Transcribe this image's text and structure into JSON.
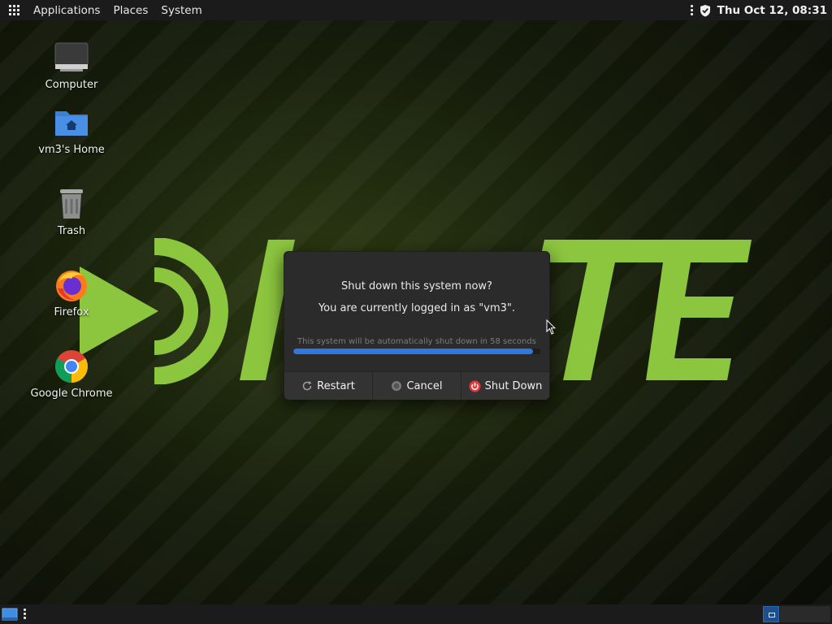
{
  "topbar": {
    "menus": [
      "Applications",
      "Places",
      "System"
    ],
    "clock": "Thu Oct 12, 08:31"
  },
  "desktop": {
    "icons": [
      {
        "label": "Computer",
        "icon": "computer-icon"
      },
      {
        "label": "vm3's Home",
        "icon": "home-folder-icon"
      },
      {
        "label": "Trash",
        "icon": "trash-icon"
      },
      {
        "label": "Firefox",
        "icon": "firefox-icon"
      },
      {
        "label": "Google Chrome",
        "icon": "chrome-icon"
      }
    ],
    "wallpaper_logo_color": "#8cc63f"
  },
  "dialog": {
    "question": "Shut down this system now?",
    "user_line": "You are currently logged in as \"vm3\".",
    "timer_text": "This system will be automatically shut down in 58 seconds",
    "progress_fraction": 0.97,
    "buttons": {
      "restart": "Restart",
      "cancel": "Cancel",
      "shutdown": "Shut Down"
    },
    "colors": {
      "progress": "#2f78e0",
      "shutdown_icon": "#e0393e"
    }
  }
}
